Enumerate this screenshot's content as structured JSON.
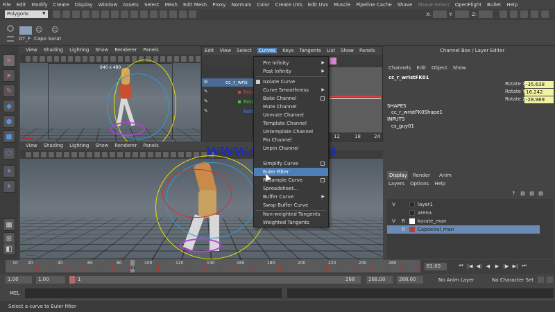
{
  "menubar": [
    "File",
    "Edit",
    "Modify",
    "Create",
    "Display",
    "Window",
    "Assets",
    "Select",
    "Mesh",
    "Edit Mesh",
    "Proxy",
    "Normals",
    "Color",
    "Create UVs",
    "Edit UVs",
    "Muscle",
    "Pipeline Cache",
    "Shave",
    "Shave Select",
    "OpenFlight",
    "Bullet",
    "Help"
  ],
  "status": {
    "mode": "Polygons",
    "x_label": "X:",
    "y_label": "Y:",
    "z_label": "Z:"
  },
  "shelf": {
    "tab1": "DT_F",
    "tab2": "Capo",
    "tab3": "karat"
  },
  "viewport_menu": [
    "View",
    "Shading",
    "Lighting",
    "Show",
    "Renderer",
    "Panels"
  ],
  "resolution_gate": "640 x 480",
  "graph_editor": {
    "menu": [
      "Edit",
      "View",
      "Select",
      "Curves",
      "Keys",
      "Tangents",
      "List",
      "Show",
      "Panels"
    ],
    "outline_title": "cc_r_wris",
    "outline_items": [
      "Rotat",
      "Rotat",
      "Rota"
    ],
    "tick_12": "12",
    "tick_18": "18",
    "tick_24": "24"
  },
  "curves_menu": {
    "items": [
      "Pre Infinity",
      "Post Infinity",
      "Isolate Curve",
      "Curve Smoothness",
      "Bake Channel",
      "Mute Channel",
      "Unmute Channel",
      "Template Channel",
      "Untemplate Channel",
      "Pin Channel",
      "Unpin Channel",
      "Simplify Curve",
      "Euler Filter",
      "Resample Curve",
      "Spreadsheet...",
      "Buffer Curve",
      "Swap Buffer Curve",
      "Non-weighted Tangents",
      "Weighted Tangents"
    ],
    "highlighted": "Euler Filter"
  },
  "watermark": "www.cgtsj.com",
  "channel_box": {
    "title": "Channel Box / Layer Editor",
    "menu": [
      "Channels",
      "Edit",
      "Object",
      "Show"
    ],
    "node": "cc_r_wristFK01",
    "attrs": [
      {
        "name": "Rotate X",
        "value": "-35.638"
      },
      {
        "name": "Rotate Y",
        "value": "16.242"
      },
      {
        "name": "Rotate Z",
        "value": "-28.969"
      }
    ],
    "shapes_header": "SHAPES",
    "shape": "cc_r_wristFK0Shape1",
    "inputs_header": "INPUTS",
    "input": "cs_guy01"
  },
  "layer_editor": {
    "tabs": [
      "Display",
      "Render",
      "Anim"
    ],
    "menu": [
      "Layers",
      "Options",
      "Help"
    ],
    "layers": [
      {
        "v": "V",
        "r": "",
        "name": "layer1",
        "color": "#2a2a2a"
      },
      {
        "v": "",
        "r": "",
        "name": "arena",
        "color": "#2a2a2a"
      },
      {
        "v": "V",
        "r": "R",
        "name": "karate_man",
        "color": "#ffffff"
      },
      {
        "v": "",
        "r": "R",
        "name": "Capoeiral_man",
        "color": "#b44038"
      }
    ]
  },
  "timeline": {
    "ticks": [
      "10",
      "20",
      "40",
      "60",
      "80",
      "100",
      "120",
      "140",
      "160",
      "180",
      "200",
      "220",
      "240",
      "260"
    ],
    "current_frame": "81",
    "end_frame": "81.00",
    "range_fraction": 0.32
  },
  "range": {
    "start": "1.00",
    "start2": "1.00",
    "slider_start": "1",
    "slider_end": "268",
    "end": "268.00",
    "end2": "268.00",
    "anim_layer": "No Anim Layer",
    "character_set": "No Character Set"
  },
  "command": {
    "label": "MEL"
  },
  "help_line": "Select a curve to Euler filter",
  "colors": {
    "highlight": "#4f7fb8",
    "selected_layer": "#6a8bb5",
    "field": "#f2f2a0"
  }
}
